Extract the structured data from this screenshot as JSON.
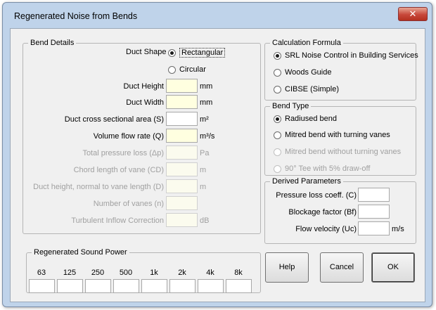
{
  "window": {
    "title": "Regenerated Noise from Bends",
    "close_symbol": "✕"
  },
  "bend_details": {
    "legend": "Bend Details",
    "duct_shape_label": "Duct Shape",
    "shape_options": [
      {
        "label": "Rectangular",
        "selected": true
      },
      {
        "label": "Circular",
        "selected": false
      }
    ],
    "fields": [
      {
        "label": "Duct Height",
        "unit": "mm",
        "enabled": true,
        "value": ""
      },
      {
        "label": "Duct Width",
        "unit": "mm",
        "enabled": true,
        "value": ""
      },
      {
        "label": "Duct cross sectional area (S)",
        "unit": "m²",
        "enabled": true,
        "value": ""
      },
      {
        "label": "Volume flow rate (Q)",
        "unit": "m³/s",
        "enabled": true,
        "value": ""
      },
      {
        "label": "Total pressure loss (Δp)",
        "unit": "Pa",
        "enabled": false,
        "value": ""
      },
      {
        "label": "Chord length of vane (CD)",
        "unit": "m",
        "enabled": false,
        "value": ""
      },
      {
        "label": "Duct height, normal to vane length (D)",
        "unit": "m",
        "enabled": false,
        "value": ""
      },
      {
        "label": "Number of vanes (n)",
        "unit": "",
        "enabled": false,
        "value": ""
      },
      {
        "label": "Turbulent Inflow Correction",
        "unit": "dB",
        "enabled": false,
        "value": ""
      }
    ]
  },
  "calculation_formula": {
    "legend": "Calculation Formula",
    "options": [
      {
        "label": "SRL Noise Control in Building Services",
        "selected": true
      },
      {
        "label": "Woods Guide",
        "selected": false
      },
      {
        "label": "CIBSE (Simple)",
        "selected": false
      }
    ]
  },
  "bend_type": {
    "legend": "Bend Type",
    "options": [
      {
        "label": "Radiused bend",
        "selected": true,
        "enabled": true
      },
      {
        "label": "Mitred bend with turning vanes",
        "selected": false,
        "enabled": true
      },
      {
        "label": "Mitred bend without turning vanes",
        "selected": false,
        "enabled": false
      },
      {
        "label": "90° Tee with 5% draw-off",
        "selected": false,
        "enabled": false
      }
    ]
  },
  "derived_parameters": {
    "legend": "Derived Parameters",
    "fields": [
      {
        "label": "Pressure loss coeff. (C)",
        "unit": "",
        "value": ""
      },
      {
        "label": "Blockage factor (Bf)",
        "unit": "",
        "value": ""
      },
      {
        "label": "Flow velocity (Uc)",
        "unit": "m/s",
        "value": ""
      }
    ]
  },
  "sound_power": {
    "legend": "Regenerated Sound Power",
    "bands": [
      "63",
      "125",
      "250",
      "500",
      "1k",
      "2k",
      "4k",
      "8k"
    ],
    "values": [
      "",
      "",
      "",
      "",
      "",
      "",
      "",
      ""
    ]
  },
  "buttons": {
    "help": "Help",
    "cancel": "Cancel",
    "ok": "OK"
  }
}
